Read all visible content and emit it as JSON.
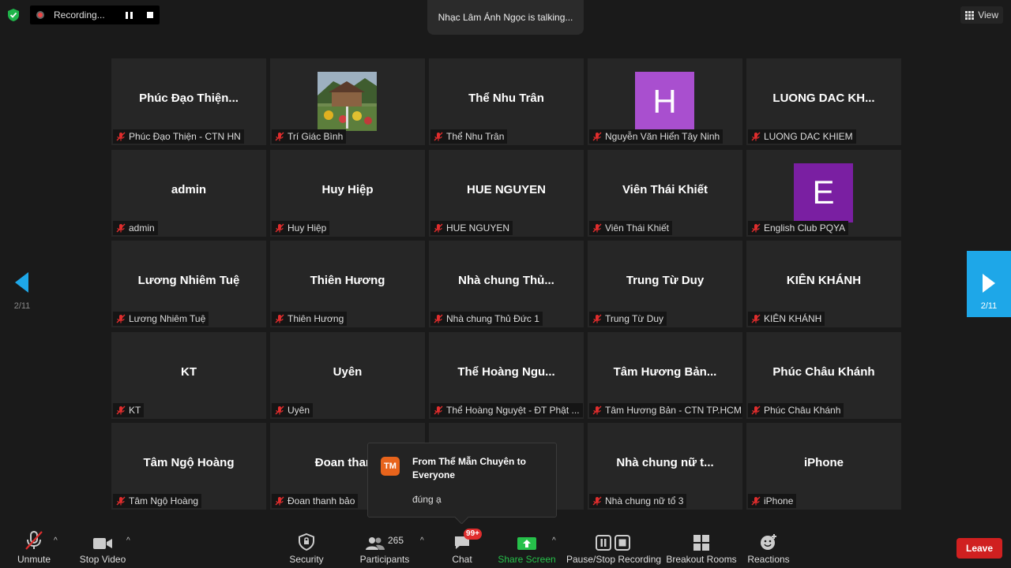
{
  "recording": {
    "label": "Recording..."
  },
  "talking": {
    "text": "Nhạc Lâm Ánh Ngọc is talking..."
  },
  "view": {
    "label": "View"
  },
  "colors": {
    "share_green": "#26c04a",
    "leave_red": "#d02020",
    "nav_blue": "#1ea7e8",
    "avatar_h": "#a94fcf",
    "avatar_e": "#7a1fa2",
    "chat_avatar": "#e8641c"
  },
  "pagination": {
    "left": "2/11",
    "right": "2/11"
  },
  "tiles": [
    {
      "name": "Phúc Đạo Thiện...",
      "label": "Phúc Đạo Thiện - CTN HN"
    },
    {
      "name": "",
      "label": "Trí Giác Bình",
      "photo": true
    },
    {
      "name": "Thể Nhu Trân",
      "label": "Thể Nhu Trân"
    },
    {
      "name": "",
      "label": "Nguyễn Văn Hiển Tây Ninh",
      "avatar": "H",
      "avatar_color": "#a94fcf"
    },
    {
      "name": "LUONG DAC KH...",
      "label": "LUONG DAC KHIEM"
    },
    {
      "name": "admin",
      "label": "admin"
    },
    {
      "name": "Huy Hiệp",
      "label": "Huy Hiệp"
    },
    {
      "name": "HUE NGUYEN",
      "label": "HUE NGUYEN"
    },
    {
      "name": "Viên Thái Khiết",
      "label": "Viên Thái Khiết"
    },
    {
      "name": "",
      "label": "English Club PQYA",
      "avatar": "E",
      "avatar_color": "#7a1fa2"
    },
    {
      "name": "Lương Nhiêm Tuệ",
      "label": "Lương Nhiêm Tuệ"
    },
    {
      "name": "Thiên Hương",
      "label": "Thiên Hương"
    },
    {
      "name": "Nhà chung Thủ...",
      "label": "Nhà chung Thủ Đức 1"
    },
    {
      "name": "Trung Từ Duy",
      "label": "Trung Từ Duy"
    },
    {
      "name": "KIÊN KHÁNH",
      "label": "KIÊN KHÁNH"
    },
    {
      "name": "KT",
      "label": "KT"
    },
    {
      "name": "Uyên",
      "label": "Uyên"
    },
    {
      "name": "Thể Hoàng Ngu...",
      "label": "Thể Hoàng Nguyệt - ĐT Phật ..."
    },
    {
      "name": "Tâm Hương Bản...",
      "label": "Tâm Hương Bản - CTN TP.HCM"
    },
    {
      "name": "Phúc Châu Khánh",
      "label": "Phúc Châu Khánh"
    },
    {
      "name": "Tâm Ngộ Hoàng",
      "label": "Tâm Ngộ Hoàng"
    },
    {
      "name": "Đoan thanh",
      "label": "Đoan thanh bảo"
    },
    {
      "name": "",
      "label": ""
    },
    {
      "name": "Nhà chung nữ t...",
      "label": "Nhà chung nữ tổ 3"
    },
    {
      "name": "iPhone",
      "label": "iPhone"
    }
  ],
  "chat_popup": {
    "initials": "TM",
    "from": "From Thể Mẫn Chuyên to Everyone",
    "message": "đúng ạ"
  },
  "toolbar": {
    "unmute": "Unmute",
    "stop_video": "Stop Video",
    "security": "Security",
    "participants": "Participants",
    "participants_count": "265",
    "chat": "Chat",
    "chat_badge": "99+",
    "share_screen": "Share Screen",
    "pause_recording": "Pause/Stop Recording",
    "breakout_rooms": "Breakout Rooms",
    "reactions": "Reactions",
    "leave": "Leave"
  }
}
